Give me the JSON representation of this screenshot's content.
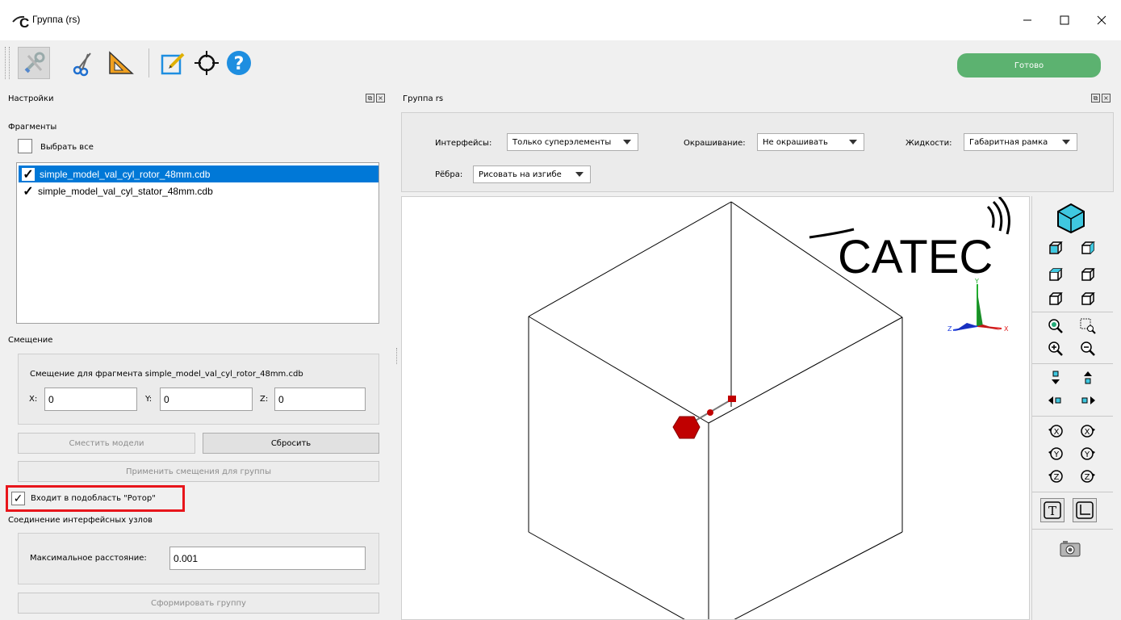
{
  "window": {
    "title": "Группа (rs)"
  },
  "toolbar": {
    "ready_label": "Готово"
  },
  "left_panel": {
    "header": "Настройки",
    "fragments_title": "Фрагменты",
    "select_all": "Выбрать все",
    "fragments": [
      {
        "name": "simple_model_val_cyl_rotor_48mm.cdb",
        "checked": true,
        "selected": true
      },
      {
        "name": "simple_model_val_cyl_stator_48mm.cdb",
        "checked": true,
        "selected": false
      }
    ],
    "offset_title": "Смещение",
    "offset_caption": "Смещение для фрагмента simple_model_val_cyl_rotor_48mm.cdb",
    "x_label": "X:",
    "x_value": "0",
    "y_label": "Y:",
    "y_value": "0",
    "z_label": "Z:",
    "z_value": "0",
    "move_models": "Сместить модели",
    "reset": "Сбросить",
    "apply_offsets": "Применить смещения для группы",
    "rotor_checkbox": "Входит в подобласть \"Ротор\"",
    "rotor_checked": true,
    "iface_title": "Соединение интерфейсных узлов",
    "max_dist_label": "Максимальное расстояние:",
    "max_dist_value": "0.001",
    "build_group": "Сформировать группу"
  },
  "right_panel": {
    "header": "Группа rs",
    "interfaces_label": "Интерфейсы:",
    "interfaces_value": "Только суперэлементы",
    "coloring_label": "Окрашивание:",
    "coloring_value": "Не окрашивать",
    "liquids_label": "Жидкости:",
    "liquids_value": "Габаритная рамка",
    "edges_label": "Рёбра:",
    "edges_value": "Рисовать на изгибе",
    "logo_text": "CATEC",
    "axis_x": "X",
    "axis_y": "Y",
    "axis_z": "Z"
  },
  "colors": {
    "accent": "#0078d7",
    "ready": "#5cb270",
    "highlight": "#e8151b",
    "cube": "#3fc8e0",
    "model": "#c00000"
  }
}
